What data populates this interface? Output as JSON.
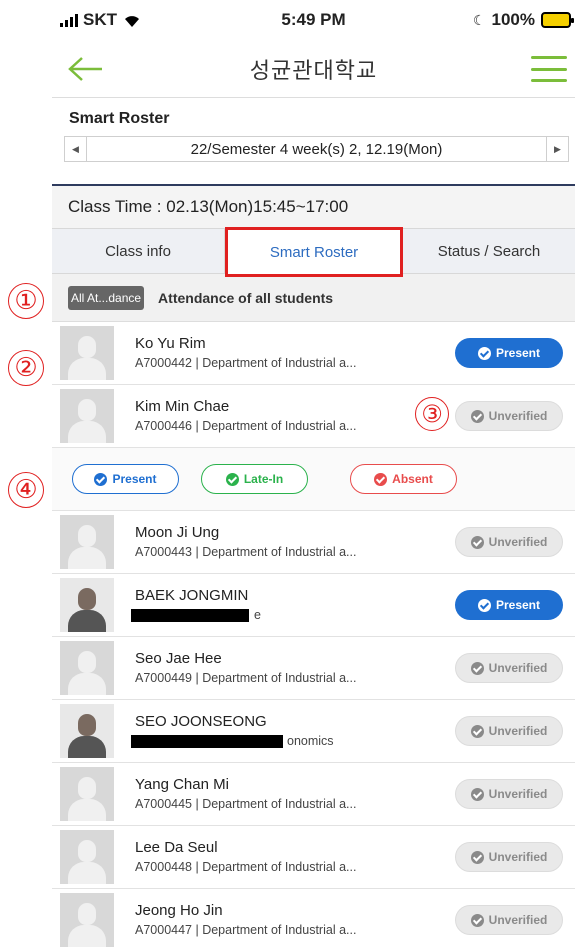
{
  "status_bar": {
    "carrier": "SKT",
    "time": "5:49 PM",
    "battery": "100%"
  },
  "nav": {
    "title": "성균관대학교"
  },
  "roster": {
    "title": "Smart Roster",
    "semester": "22/Semester 4 week(s) 2, 12.19(Mon)",
    "class_time": "Class Time : 02.13(Mon)15:45~17:00"
  },
  "tabs": [
    {
      "label": "Class info"
    },
    {
      "label": "Smart Roster"
    },
    {
      "label": "Status / Search"
    }
  ],
  "all_attendance": {
    "button": "All At...dance",
    "text": "Attendance of all students"
  },
  "choices": {
    "present": "Present",
    "late": "Late-In",
    "absent": "Absent"
  },
  "students": [
    {
      "name": "Ko Yu Rim",
      "info": "A7000442 | Department of Industrial a...",
      "status": "Present"
    },
    {
      "name": "Kim Min Chae",
      "info": "A7000446 | Department of Industrial a...",
      "status": "Unverified"
    },
    {
      "name": "Moon Ji Ung",
      "info": "A7000443 | Department of Industrial a...",
      "status": "Unverified"
    },
    {
      "name": "BAEK JONGMIN",
      "info": "e",
      "status": "Present"
    },
    {
      "name": "Seo Jae Hee",
      "info": "A7000449 | Department of Industrial a...",
      "status": "Unverified"
    },
    {
      "name": "SEO JOONSEONG",
      "info": "onomics",
      "status": "Unverified"
    },
    {
      "name": "Yang Chan Mi",
      "info": "A7000445 | Department of Industrial a...",
      "status": "Unverified"
    },
    {
      "name": "Lee Da Seul",
      "info": "A7000448 | Department of Industrial a...",
      "status": "Unverified"
    },
    {
      "name": "Jeong Ho Jin",
      "info": "A7000447 | Department of Industrial a...",
      "status": "Unverified"
    }
  ],
  "callouts": [
    "①",
    "②",
    "③",
    "④"
  ],
  "colors": {
    "accent_green": "#7bbd3a",
    "present_blue": "#1f6fd1",
    "late_green": "#2bb24c",
    "absent_red": "#e84c4c",
    "highlight_red": "#e02020"
  }
}
